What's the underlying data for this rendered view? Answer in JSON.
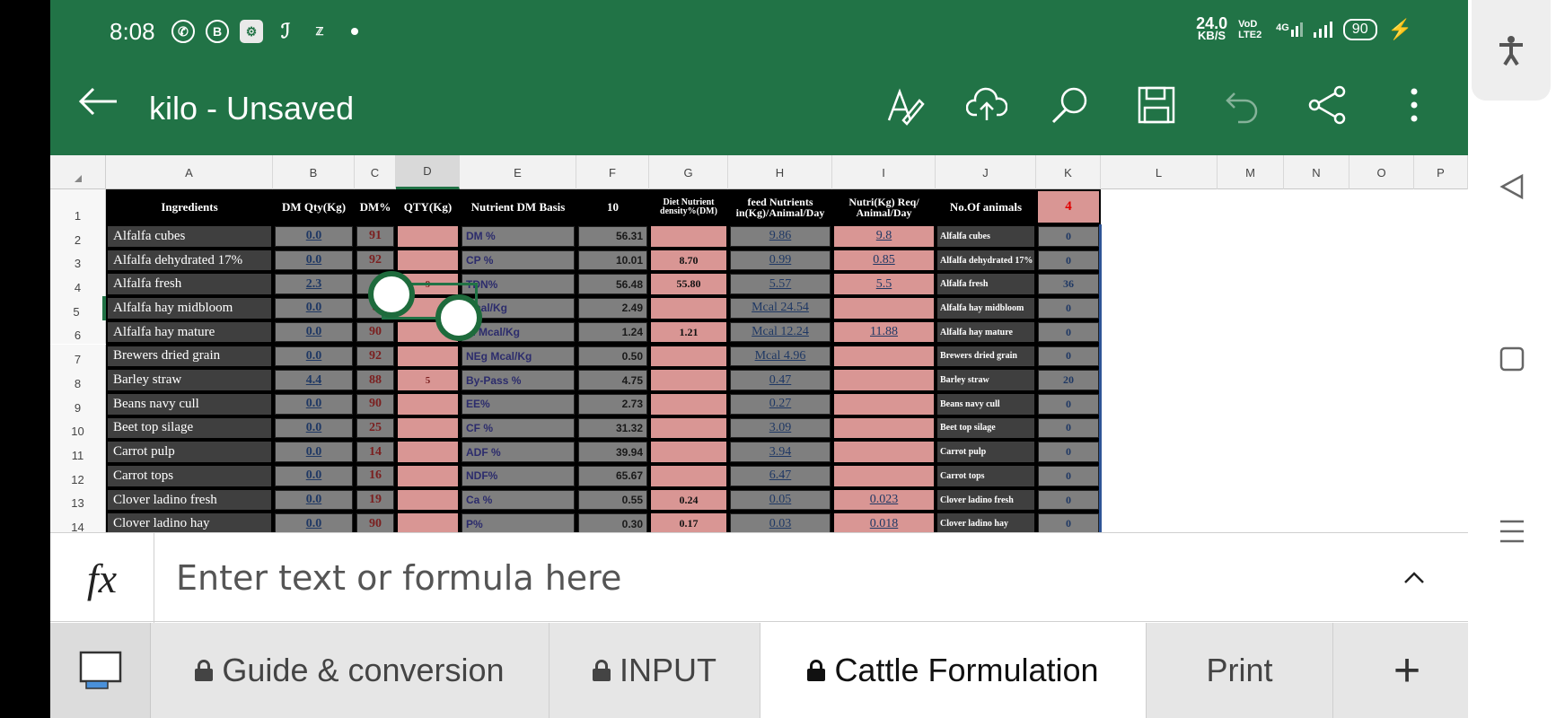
{
  "status": {
    "time": "8:08",
    "net_speed": "24.0",
    "net_unit": "KB/S",
    "volte": "VoD LTE2",
    "network": "4G",
    "battery": "90"
  },
  "app": {
    "title": "kilo - Unsaved",
    "accent": "#217346"
  },
  "columns": [
    "A",
    "B",
    "C",
    "D",
    "E",
    "F",
    "G",
    "H",
    "I",
    "J",
    "K",
    "L",
    "M",
    "N",
    "O",
    "P"
  ],
  "row_numbers": [
    "1",
    "2",
    "3",
    "4",
    "5",
    "6",
    "7",
    "8",
    "9",
    "10",
    "11",
    "12",
    "13",
    "14"
  ],
  "header": {
    "A": "Ingredients",
    "B": "DM Qty(Kg)",
    "C": "DM%",
    "D": "QTY(Kg)",
    "E": "Nutrient DM Basis",
    "F": "10",
    "G": "Diet Nutrient density%(DM)",
    "H": "feed Nutrients in(Kg)/Animal/Day",
    "I": "Nutri(Kg) Req/ Animal/Day",
    "J": "No.Of animals",
    "K": "4"
  },
  "rows": [
    {
      "A": "Alfalfa cubes",
      "B": "0.0",
      "C": "91",
      "D": "",
      "E": "DM %",
      "F": "56.31",
      "G": "",
      "H": "9.86",
      "I": "9.8",
      "J": "Alfalfa cubes",
      "K": "0"
    },
    {
      "A": "Alfalfa dehydrated 17%",
      "B": "0.0",
      "C": "92",
      "D": "",
      "E": "CP %",
      "F": "10.01",
      "G": "8.70",
      "H": "0.99",
      "I": "0.85",
      "J": "Alfalfa dehydrated 17%",
      "K": "0"
    },
    {
      "A": "Alfalfa fresh",
      "B": "2.3",
      "C": "",
      "D": "9",
      "E": "TDN%",
      "F": "56.48",
      "G": "55.80",
      "H": "5.57",
      "I": "5.5",
      "J": "Alfalfa fresh",
      "K": "36"
    },
    {
      "A": "Alfalfa hay midbloom",
      "B": "0.0",
      "C": "8",
      "D": "",
      "E": "Mcal/Kg",
      "F": "2.49",
      "G": "",
      "H": "Mcal 24.54",
      "I": "",
      "J": "Alfalfa hay midbloom",
      "K": "0"
    },
    {
      "A": "Alfalfa hay mature",
      "B": "0.0",
      "C": "90",
      "D": "",
      "E": "m Mcal/Kg",
      "F": "1.24",
      "G": "1.21",
      "H": "Mcal 12.24",
      "I": "11.88",
      "J": "Alfalfa hay mature",
      "K": "0"
    },
    {
      "A": "Brewers dried grain",
      "B": "0.0",
      "C": "92",
      "D": "",
      "E": "NEg Mcal/Kg",
      "F": "0.50",
      "G": "",
      "H": "Mcal 4.96",
      "I": "",
      "J": "Brewers dried grain",
      "K": "0"
    },
    {
      "A": "Barley straw",
      "B": "4.4",
      "C": "88",
      "D": "5",
      "E": "By-Pass %",
      "F": "4.75",
      "G": "",
      "H": "0.47",
      "I": "",
      "J": "Barley straw",
      "K": "20"
    },
    {
      "A": "Beans navy cull",
      "B": "0.0",
      "C": "90",
      "D": "",
      "E": "EE%",
      "F": "2.73",
      "G": "",
      "H": "0.27",
      "I": "",
      "J": "Beans navy cull",
      "K": "0"
    },
    {
      "A": "Beet top silage",
      "B": "0.0",
      "C": "25",
      "D": "",
      "E": "CF %",
      "F": "31.32",
      "G": "",
      "H": "3.09",
      "I": "",
      "J": "Beet top silage",
      "K": "0"
    },
    {
      "A": "Carrot pulp",
      "B": "0.0",
      "C": "14",
      "D": "",
      "E": "ADF %",
      "F": "39.94",
      "G": "",
      "H": "3.94",
      "I": "",
      "J": "Carrot pulp",
      "K": "0"
    },
    {
      "A": "Carrot tops",
      "B": "0.0",
      "C": "16",
      "D": "",
      "E": "NDF%",
      "F": "65.67",
      "G": "",
      "H": "6.47",
      "I": "",
      "J": "Carrot tops",
      "K": "0"
    },
    {
      "A": "Clover ladino fresh",
      "B": "0.0",
      "C": "19",
      "D": "",
      "E": "Ca %",
      "F": "0.55",
      "G": "0.24",
      "H": "0.05",
      "I": "0.023",
      "J": "Clover ladino fresh",
      "K": "0"
    },
    {
      "A": "Clover ladino hay",
      "B": "0.0",
      "C": "90",
      "D": "",
      "E": "P%",
      "F": "0.30",
      "G": "0.17",
      "H": "0.03",
      "I": "0.018",
      "J": "Clover ladino hay",
      "K": "0"
    }
  ],
  "formula_bar": {
    "fx_label": "fx",
    "placeholder": "Enter text or formula here"
  },
  "sheet_tabs": [
    {
      "label": "Guide & conversion",
      "locked": true
    },
    {
      "label": "INPUT",
      "locked": true
    },
    {
      "label": "Cattle Formulation",
      "locked": true,
      "active": true
    },
    {
      "label": "Print",
      "locked": false
    }
  ],
  "add_sheet": "+"
}
